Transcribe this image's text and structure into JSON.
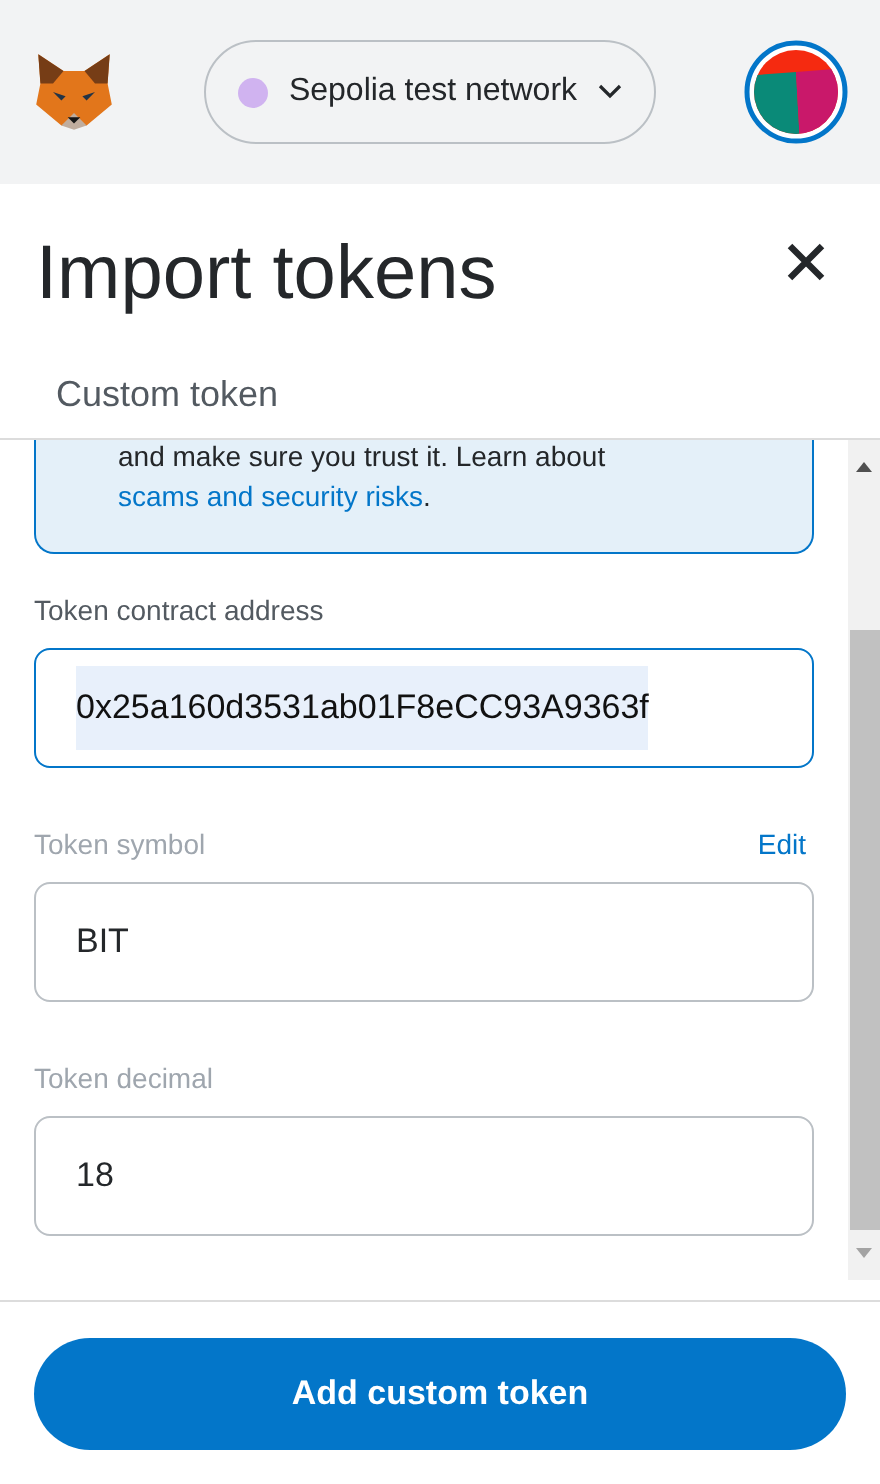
{
  "header": {
    "network": {
      "label": "Sepolia test network",
      "color": "#d0b3f0"
    }
  },
  "title": "Import tokens",
  "tabs": [
    {
      "label": "Custom token",
      "selected": false
    }
  ],
  "alert": {
    "text": "and make sure you trust it. Learn about ",
    "link": "scams and security risks",
    "after": "."
  },
  "fields": [
    {
      "label": "Token contract address",
      "value": "0x25a160d3531ab01F8eCC93A9363f",
      "disabled": false,
      "focused": true,
      "highlighted": true
    },
    {
      "label": "Token symbol",
      "value": "BIT",
      "action": "Edit",
      "disabled": true,
      "focused": false,
      "highlighted": false
    },
    {
      "label": "Token decimal",
      "value": "18",
      "disabled": true,
      "focused": false,
      "highlighted": false
    }
  ],
  "button": "Add custom token"
}
